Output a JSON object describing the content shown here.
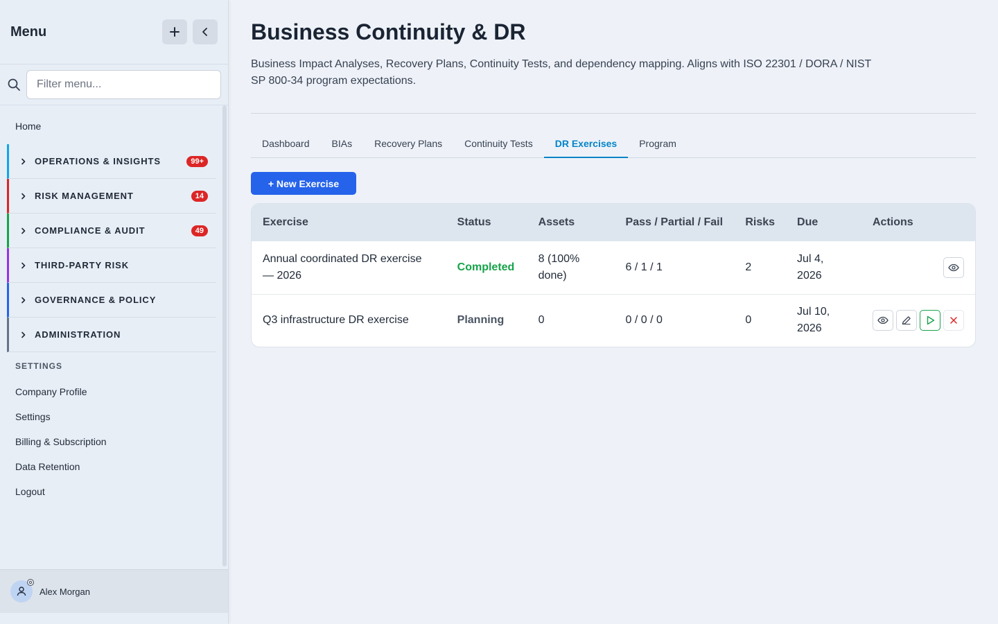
{
  "sidebar": {
    "title": "Menu",
    "filter_placeholder": "Filter menu...",
    "home_label": "Home",
    "sections": [
      {
        "label": "OPERATIONS & INSIGHTS",
        "badge": "99+",
        "color": "#0ea5e9"
      },
      {
        "label": "RISK MANAGEMENT",
        "badge": "14",
        "color": "#dc2626"
      },
      {
        "label": "COMPLIANCE & AUDIT",
        "badge": "49",
        "color": "#16a34a"
      },
      {
        "label": "THIRD-PARTY RISK",
        "badge": "",
        "color": "#9333ea"
      },
      {
        "label": "GOVERNANCE & POLICY",
        "badge": "",
        "color": "#2563eb"
      },
      {
        "label": "ADMINISTRATION",
        "badge": "",
        "color": "#64748b"
      }
    ],
    "settings_heading": "SETTINGS",
    "settings_links": [
      "Company Profile",
      "Settings",
      "Billing & Subscription",
      "Data Retention",
      "Logout"
    ],
    "user_name": "Alex Morgan"
  },
  "page": {
    "title": "Business Continuity & DR",
    "description": "Business Impact Analyses, Recovery Plans, Continuity Tests, and dependency mapping. Aligns with ISO 22301 / DORA / NIST SP 800-34 program expectations."
  },
  "tabs": [
    "Dashboard",
    "BIAs",
    "Recovery Plans",
    "Continuity Tests",
    "DR Exercises",
    "Program"
  ],
  "active_tab": "DR Exercises",
  "new_button_label": "+ New Exercise",
  "table": {
    "headers": [
      "Exercise",
      "Status",
      "Assets",
      "Pass / Partial / Fail",
      "Risks",
      "Due",
      "Actions"
    ],
    "rows": [
      {
        "exercise": "Annual coordinated DR exercise — 2026",
        "status": "Completed",
        "assets": "8 (100% done)",
        "ppf": "6 / 1 / 1",
        "risks": "2",
        "due": "Jul 4, 2026"
      },
      {
        "exercise": "Q3 infrastructure DR exercise",
        "status": "Planning",
        "assets": "0",
        "ppf": "0 / 0 / 0",
        "risks": "0",
        "due": "Jul 10, 2026"
      }
    ]
  },
  "colors": {
    "primary": "#2563eb",
    "active_tab": "#0284c7",
    "completed": "#16a34a",
    "badge": "#dc2626"
  }
}
